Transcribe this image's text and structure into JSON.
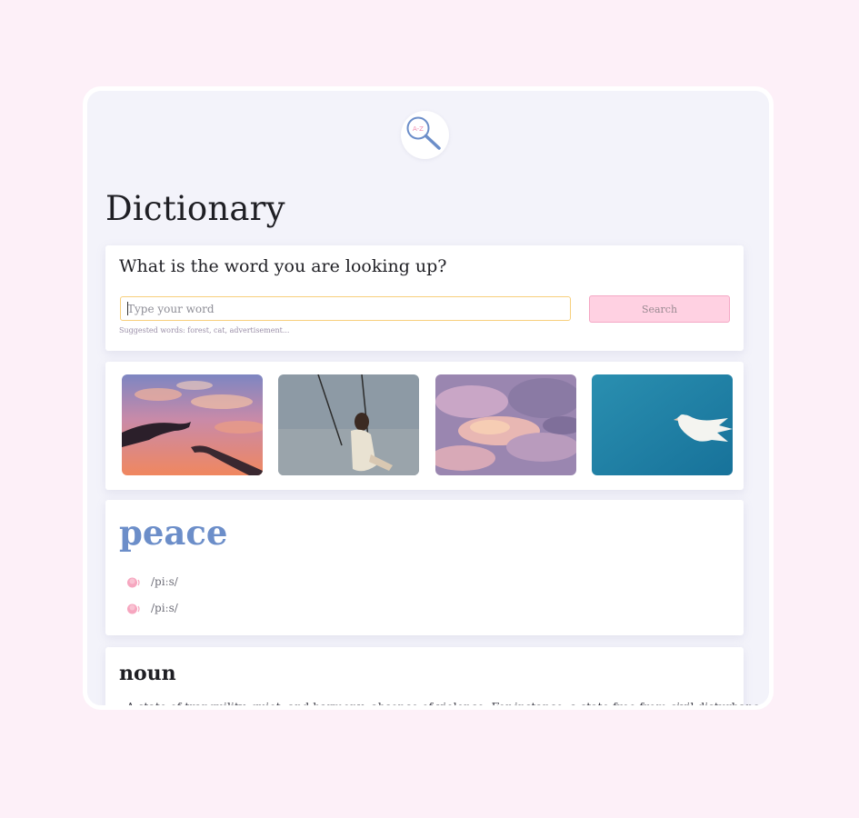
{
  "app": {
    "title": "Dictionary",
    "logo_icon": "magnifier-a-z-icon",
    "logo_text": "A-Z"
  },
  "search": {
    "heading": "What is the word you are looking up?",
    "placeholder": "Type your word",
    "value": "",
    "button_label": "Search",
    "suggested": "Suggested words: forest, cat, advertisement..."
  },
  "gallery": {
    "images": [
      {
        "name": "photo-hands-sunset",
        "description_icon": "image"
      },
      {
        "name": "photo-girl-on-swing",
        "description_icon": "image"
      },
      {
        "name": "photo-clouds-pink",
        "description_icon": "image"
      },
      {
        "name": "photo-white-dove",
        "description_icon": "image"
      }
    ]
  },
  "result": {
    "word": "peace",
    "phonetics": [
      {
        "text": "/piːs/",
        "icon": "speaker-icon"
      },
      {
        "text": "/piːs/",
        "icon": "speaker-icon"
      }
    ]
  },
  "meaning": {
    "part_of_speech": "noun",
    "definition": "A state of tranquility, quiet, and harmony; absence of violence. For instance, a state free from civil disturbance."
  },
  "colors": {
    "background": "#fdf0f8",
    "panel": "#f3f3fa",
    "accent_word": "#6c8ec9",
    "search_button": "#ffd1e2",
    "input_border": "#f7cf7c"
  }
}
